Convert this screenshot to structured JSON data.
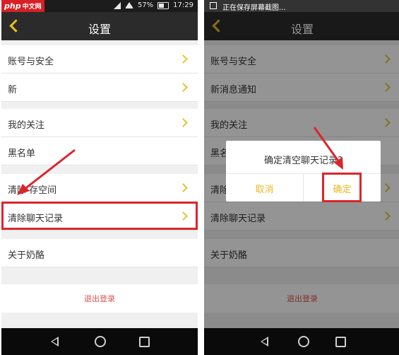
{
  "left_screen": {
    "status": {
      "battery": "57%",
      "time": "17:29",
      "logo_text": "php",
      "logo_sub": "中文网"
    },
    "header": {
      "title": "设置"
    },
    "groups": [
      {
        "items": [
          {
            "label": "账号与安全"
          },
          {
            "label": "新"
          }
        ]
      },
      {
        "items": [
          {
            "label": "我的关注"
          },
          {
            "label": "黑名单"
          }
        ]
      },
      {
        "items": [
          {
            "label": "清除  存空间"
          },
          {
            "label": "清除聊天记录"
          }
        ]
      },
      {
        "items": [
          {
            "label": "关于奶酪"
          }
        ]
      }
    ],
    "logout": "退出登录"
  },
  "right_screen": {
    "status": {
      "notification": "正在保存屏幕截图..."
    },
    "header": {
      "title": "设置"
    },
    "rows": [
      {
        "label": "账号与安全"
      },
      {
        "label": "新消息通知"
      },
      {
        "label": "我的关注"
      },
      {
        "label": "黑名"
      },
      {
        "label": "清除"
      },
      {
        "label": "清除聊天记录"
      },
      {
        "label": "关于奶酪"
      }
    ],
    "logout": "退出登录",
    "dialog": {
      "message": "确定清空聊天记录?",
      "cancel": "取消",
      "confirm": "确定"
    }
  },
  "colors": {
    "accent": "#e8b923",
    "highlight": "#d9262b",
    "logout": "#d9534f"
  }
}
